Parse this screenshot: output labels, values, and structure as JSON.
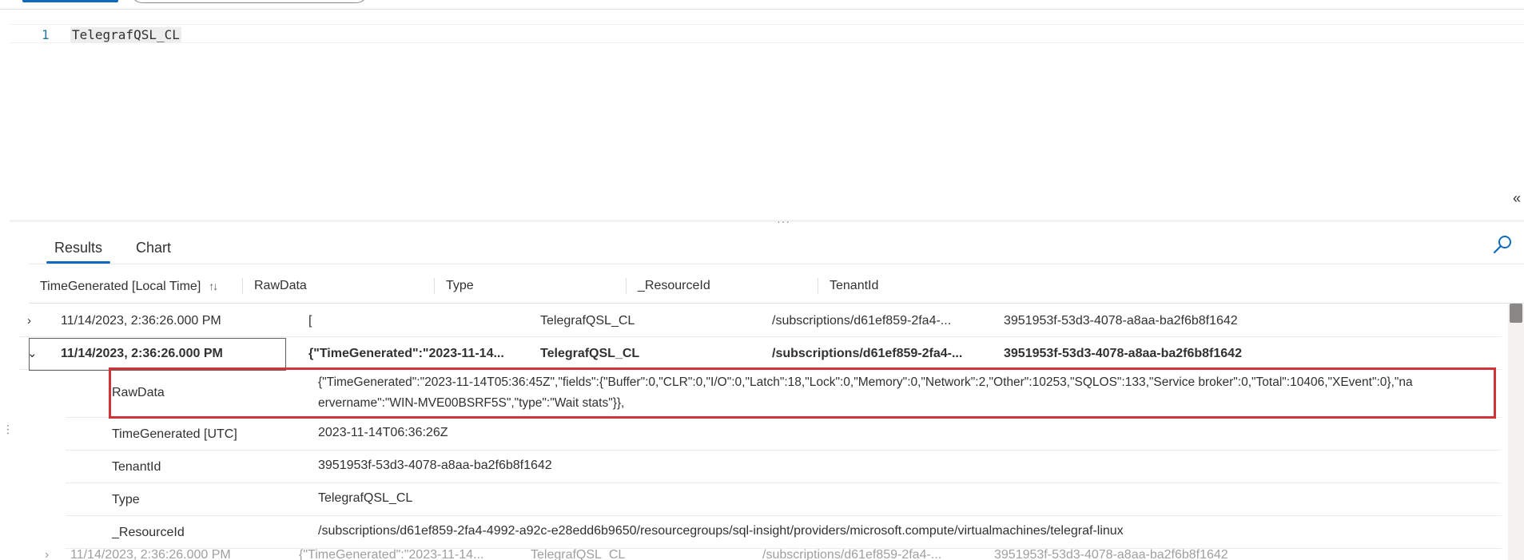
{
  "editor": {
    "line_number": "1",
    "query": "TelegrafQSL_CL"
  },
  "tabs": [
    {
      "label": "Results",
      "active": true
    },
    {
      "label": "Chart",
      "active": false
    }
  ],
  "grid": {
    "columns": [
      {
        "label": "TimeGenerated [Local Time]",
        "sort_icon": "↑↓"
      },
      {
        "label": "RawData"
      },
      {
        "label": "Type"
      },
      {
        "label": "_ResourceId"
      },
      {
        "label": "TenantId"
      }
    ],
    "rows": [
      {
        "expanded": false,
        "time": "11/14/2023, 2:36:26.000 PM",
        "rawdata": "[",
        "type": "TelegrafQSL_CL",
        "resourceid": "/subscriptions/d61ef859-2fa4-...",
        "tenantid": "3951953f-53d3-4078-a8aa-ba2f6b8f1642"
      },
      {
        "expanded": true,
        "time": "11/14/2023, 2:36:26.000 PM",
        "rawdata": "{\"TimeGenerated\":\"2023-11-14...",
        "type": "TelegrafQSL_CL",
        "resourceid": "/subscriptions/d61ef859-2fa4-...",
        "tenantid": "3951953f-53d3-4078-a8aa-ba2f6b8f1642"
      }
    ],
    "details": [
      {
        "name": "RawData",
        "value_line1": "{\"TimeGenerated\":\"2023-11-14T05:36:45Z\",\"fields\":{\"Buffer\":0,\"CLR\":0,\"I/O\":0,\"Latch\":18,\"Lock\":0,\"Memory\":0,\"Network\":2,\"Other\":10253,\"SQLOS\":133,\"Service broker\":0,\"Total\":10406,\"XEvent\":0},\"na",
        "value_line2": "ervername\":\"WIN-MVE00BSRF5S\",\"type\":\"Wait stats\"}},"
      },
      {
        "name": "TimeGenerated [UTC]",
        "value": "2023-11-14T06:36:26Z"
      },
      {
        "name": "TenantId",
        "value": "3951953f-53d3-4078-a8aa-ba2f6b8f1642"
      },
      {
        "name": "Type",
        "value": "TelegrafQSL_CL"
      },
      {
        "name": "_ResourceId",
        "value": "/subscriptions/d61ef859-2fa4-4992-a92c-e28edd6b9650/resourcegroups/sql-insight/providers/microsoft.compute/virtualmachines/telegraf-linux"
      }
    ],
    "next_row_partial": {
      "time": "11/14/2023, 2:36:26.000 PM",
      "rawdata": "{\"TimeGenerated\":\"2023-11-14...",
      "type": "TelegrafQSL_CL",
      "resourceid": "/subscriptions/d61ef859-2fa4-...",
      "tenantid": "3951953f-53d3-4078-a8aa-ba2f6b8f1642"
    }
  },
  "colors": {
    "accent": "#0f6cbd",
    "highlight": "#d13438"
  }
}
